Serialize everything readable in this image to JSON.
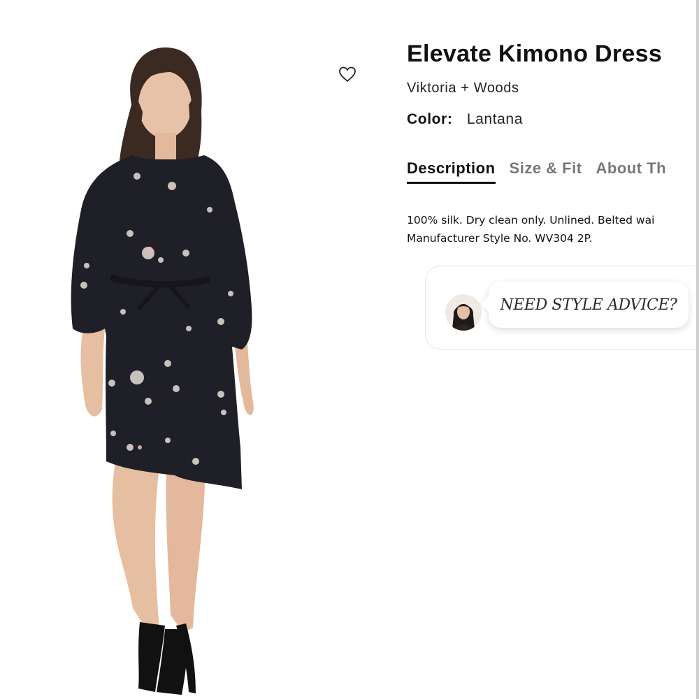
{
  "product": {
    "title": "Elevate Kimono Dress",
    "brand": "Viktoria + Woods",
    "color_label": "Color:",
    "color_value": "Lantana"
  },
  "tabs": [
    {
      "label": "Description",
      "active": true
    },
    {
      "label": "Size & Fit",
      "active": false
    },
    {
      "label": "About Th",
      "active": false
    }
  ],
  "description": {
    "line1": "100% silk. Dry clean only. Unlined. Belted wai",
    "line2": "Manufacturer Style No. WV304 2P."
  },
  "style_advice": {
    "label": "NEED STYLE ADVICE?"
  },
  "icons": {
    "favorite": "heart-outline-icon"
  },
  "colors": {
    "dress": "#1f1f27",
    "text": "#111111",
    "tab_inactive": "#777777"
  }
}
